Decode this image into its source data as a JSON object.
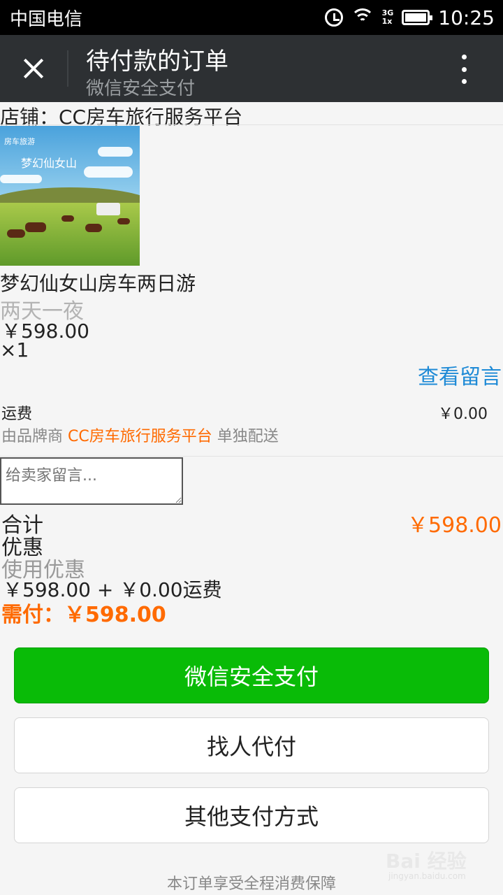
{
  "status_bar": {
    "carrier": "中国电信",
    "network_top": "3G",
    "network_bottom": "1x",
    "time": "10:25"
  },
  "title_bar": {
    "title": "待付款的订单",
    "subtitle": "微信安全支付"
  },
  "shop": {
    "label": "店铺：CC房车旅行服务平台"
  },
  "product": {
    "image_caption": "房车旅游",
    "image_title": "梦幻仙女山",
    "name": "梦幻仙女山房车两日游",
    "spec": "两天一夜",
    "price": "￥598.00",
    "quantity": "×1",
    "view_message": "查看留言"
  },
  "shipping": {
    "label": "运费",
    "fee": "￥0.00",
    "desc_prefix": "由品牌商",
    "brand": "CC房车旅行服务平台",
    "desc_suffix": "单独配送"
  },
  "message": {
    "placeholder": "给卖家留言..."
  },
  "summary": {
    "total_label": "合计",
    "total_value": "￥598.00",
    "discount_label": "优惠",
    "use_discount": "使用优惠",
    "calc_line": "￥598.00 + ￥0.00运费",
    "need_pay": "需付：￥598.00"
  },
  "buttons": {
    "wechat_pay": "微信安全支付",
    "find_payer": "找人代付",
    "other_methods": "其他支付方式"
  },
  "footer": {
    "guarantee": "本订单享受全程消费保障",
    "watermark": "Bai 经验",
    "watermark_sub": "jingyan.baidu.com"
  },
  "colors": {
    "accent_orange": "#ff6a00",
    "link_blue": "#1e8ad6",
    "pay_green": "#09bb07",
    "titlebar": "#2d3033"
  }
}
